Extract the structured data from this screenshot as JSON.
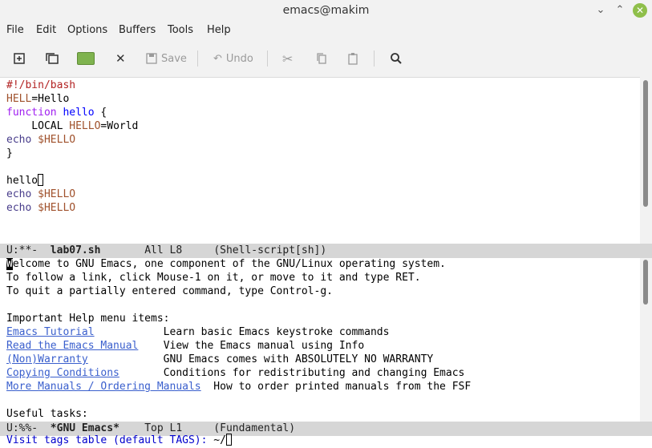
{
  "window": {
    "title": "emacs@makim"
  },
  "menu": [
    "File",
    "Edit",
    "Options",
    "Buffers",
    "Tools",
    "Help"
  ],
  "toolbar": {
    "save": "Save",
    "undo": "Undo"
  },
  "editor": {
    "l1": "#!/bin/bash",
    "l2_var": "HELL",
    "l2_rest": "=Hello",
    "l3_kw": "function",
    "l3_fn": "hello",
    "l3_rest": " {",
    "l4_kw": "    LOCAL ",
    "l4_var": "HELLO",
    "l4_rest": "=World",
    "l5_bi": "echo",
    "l5_var": "$HELLO",
    "l6": "}",
    "l8": "hello",
    "l9_bi": "echo",
    "l9_var": "$HELLO",
    "l10_bi": "echo",
    "l10_var": "$HELLO"
  },
  "modeline1": {
    "status": "U:**-  ",
    "buffer": "lab07.sh",
    "position": "       All L8     ",
    "mode": "(Shell-script[sh])"
  },
  "help": {
    "w1_first": "W",
    "w1_rest": "elcome to GNU Emacs, one component of the GNU/Linux operating system.",
    "w2": "To follow a link, click Mouse-1 on it, or move to it and type RET.",
    "w3": "To quit a partially entered command, type Control-g.",
    "w5": "Important Help menu items:",
    "items": [
      {
        "link": "Emacs Tutorial",
        "pad": "           ",
        "desc": "Learn basic Emacs keystroke commands"
      },
      {
        "link": "Read the Emacs Manual",
        "pad": "    ",
        "desc": "View the Emacs manual using Info"
      },
      {
        "link": "(Non)Warranty",
        "pad": "            ",
        "desc": "GNU Emacs comes with ABSOLUTELY NO WARRANTY"
      },
      {
        "link": "Copying Conditions",
        "pad": "       ",
        "desc": "Conditions for redistributing and changing Emacs"
      },
      {
        "link": "More Manuals / Ordering Manuals",
        "pad": "  ",
        "desc": "How to order printed manuals from the FSF"
      }
    ],
    "useful": "Useful tasks:"
  },
  "modeline2": {
    "status": "U:%%-  ",
    "buffer": "*GNU Emacs*",
    "position": "    Top L1     ",
    "mode": "(Fundamental)"
  },
  "minibuffer": {
    "prompt": "Visit tags table (default TAGS): ",
    "value": "~/"
  }
}
